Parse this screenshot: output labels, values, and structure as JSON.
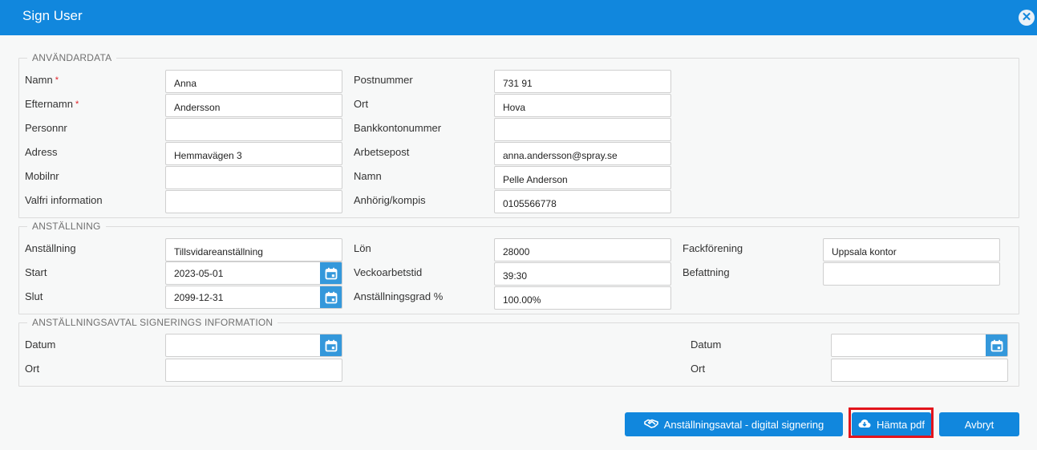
{
  "window": {
    "title": "Sign User"
  },
  "anvandardata": {
    "legend": "ANVÄNDARDATA",
    "left": [
      {
        "label": "Namn",
        "required": true,
        "value": "Anna"
      },
      {
        "label": "Efternamn",
        "required": true,
        "value": "Andersson"
      },
      {
        "label": "Personnr",
        "required": false,
        "value": ""
      },
      {
        "label": "Adress",
        "required": false,
        "value": "Hemmavägen 3"
      },
      {
        "label": "Mobilnr",
        "required": false,
        "value": ""
      },
      {
        "label": "Valfri information",
        "required": false,
        "value": ""
      }
    ],
    "right": [
      {
        "label": "Postnummer",
        "value": "731 91"
      },
      {
        "label": "Ort",
        "value": "Hova"
      },
      {
        "label": "Bankkontonummer",
        "value": ""
      },
      {
        "label": "Arbetsepost",
        "value": "anna.andersson@spray.se"
      },
      {
        "label": "Namn",
        "value": "Pelle Anderson"
      },
      {
        "label": "Anhörig/kompis",
        "value": "0105566778"
      }
    ],
    "required_mark": "*"
  },
  "anstallning": {
    "legend": "ANSTÄLLNING",
    "col1": [
      {
        "label": "Anställning",
        "value": "Tillsvidareanställning"
      },
      {
        "label": "Start",
        "value": "2023-05-01"
      },
      {
        "label": "Slut",
        "value": "2099-12-31"
      }
    ],
    "col2": [
      {
        "label": "Lön",
        "value": "28000"
      },
      {
        "label": "Veckoarbetstid",
        "value": "39:30"
      },
      {
        "label": "Anställningsgrad %",
        "value": "100.00%"
      }
    ],
    "col3": [
      {
        "label": "Fackförening",
        "value": "Uppsala kontor"
      },
      {
        "label": "Befattning",
        "value": ""
      }
    ]
  },
  "signering": {
    "legend": "ANSTÄLLNINGSAVTAL SIGNERINGS INFORMATION",
    "left": [
      {
        "label": "Datum",
        "value": ""
      },
      {
        "label": "Ort",
        "value": ""
      }
    ],
    "right": [
      {
        "label": "Datum",
        "value": ""
      },
      {
        "label": "Ort",
        "value": ""
      }
    ]
  },
  "buttons": {
    "digital_signing": "Anställningsavtal - digital signering",
    "download_pdf": "Hämta pdf",
    "cancel": "Avbryt"
  },
  "colors": {
    "titlebar": "#1187dd",
    "button": "#1187dd",
    "calendar": "#3498db",
    "highlight": "#e2141c",
    "required": "#e21f26"
  }
}
